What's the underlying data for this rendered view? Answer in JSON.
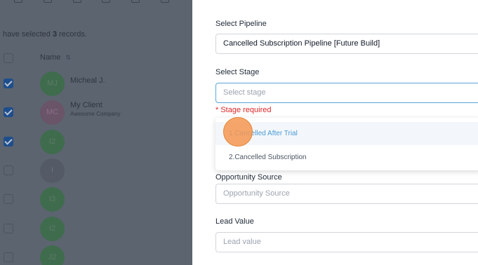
{
  "background": {
    "selection_prefix": "have selected",
    "selection_count": "3",
    "selection_suffix": "records.",
    "column_name": "Name",
    "rows": [
      {
        "initials": "MJ",
        "name": "Micheal J.",
        "sub": "",
        "checked": true,
        "color": "green"
      },
      {
        "initials": "MC",
        "name": "My Client",
        "sub": "Awesome Company",
        "checked": true,
        "color": "purple"
      },
      {
        "initials": "I2",
        "name": "",
        "sub": "",
        "checked": true,
        "color": "green"
      },
      {
        "initials": "I",
        "name": "",
        "sub": "",
        "checked": false,
        "color": "gray"
      },
      {
        "initials": "I3",
        "name": "",
        "sub": "",
        "checked": false,
        "color": "green"
      },
      {
        "initials": "I2",
        "name": "",
        "sub": "",
        "checked": false,
        "color": "green"
      },
      {
        "initials": "J2",
        "name": "",
        "sub": "",
        "checked": false,
        "color": "green"
      }
    ]
  },
  "form": {
    "pipeline_label": "Select Pipeline",
    "pipeline_value": "Cancelled Subscription Pipeline [Future Build]",
    "stage_label": "Select Stage",
    "stage_placeholder": "Select stage",
    "stage_error": "* Stage required",
    "stage_options": [
      "1.Cancelled After Trial",
      "2.Cancelled Subscription"
    ],
    "source_label": "Opportunity Source",
    "source_placeholder": "Opportunity Source",
    "lead_label": "Lead Value",
    "lead_placeholder": "Lead value"
  },
  "colors": {
    "error": "#dc2626",
    "focus_border": "#5aa6d8",
    "option_highlight": "#4a9ad6",
    "click_marker": "#f59750"
  }
}
